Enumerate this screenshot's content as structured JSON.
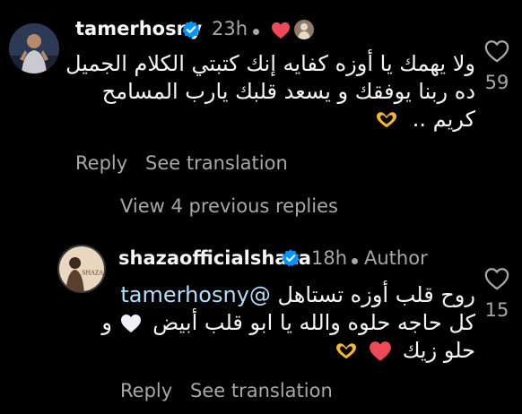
{
  "comment1": {
    "username": "tamerhosny",
    "time": "23h",
    "lines": [
      "ولا يهمك يا أوزه كفايه إنك كتبتي الكلام الجميل",
      "ده ربنا يوفقك و يسعد قلبك يارب المسامح",
      "كريم .."
    ],
    "reply_label": "Reply",
    "translate_label": "See translation",
    "likes": "59",
    "view_replies": "View 4 previous replies"
  },
  "comment2": {
    "username": "shazaofficialshaza",
    "time": "18h",
    "author_badge": "Author",
    "mention": "@tamerhosny",
    "line1_text": "روح قلب أوزه تستاهل",
    "line2": "كل حاجه حلوه والله يا ابو قلب أبيض",
    "line2_suffix": "و",
    "line3": "حلو زيك",
    "avatar_label": "SHAZA",
    "reply_label": "Reply",
    "translate_label": "See translation",
    "likes": "15"
  },
  "colors": {
    "background": "#000000",
    "primary_text": "#f5f5f5",
    "secondary_text": "#a8a8a8",
    "mention": "#b2dffc",
    "verified": "#0095f6",
    "heart_red": "#ed4956"
  },
  "icons": [
    "verified-badge-icon",
    "red-heart-icon",
    "heart-hands-icon",
    "white-heart-icon",
    "like-heart-outline-icon"
  ]
}
